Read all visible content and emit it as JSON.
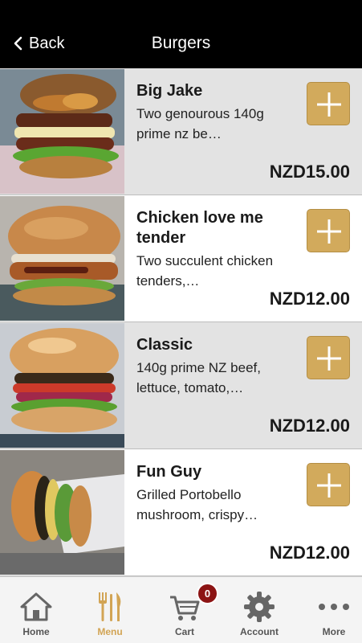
{
  "nav": {
    "back_label": "Back",
    "title": "Burgers"
  },
  "items": [
    {
      "name": "Big Jake",
      "description": "Two genourous 140g prime nz be…",
      "price": "NZD15.00",
      "image_icon": "burger-photo"
    },
    {
      "name": "Chicken love me tender",
      "description": "Two succulent chicken tenders,…",
      "price": "NZD12.00",
      "image_icon": "burger-photo"
    },
    {
      "name": "Classic",
      "description": "140g prime NZ beef, lettuce, tomato,…",
      "price": "NZD12.00",
      "image_icon": "burger-photo"
    },
    {
      "name": "Fun Guy",
      "description": "Grilled Portobello mushroom, crispy…",
      "price": "NZD12.00",
      "image_icon": "burger-photo"
    }
  ],
  "add_icon": "plus-icon",
  "tabs": [
    {
      "label": "Home",
      "icon": "home-icon"
    },
    {
      "label": "Menu",
      "icon": "fork-knife-icon",
      "active": true
    },
    {
      "label": "Cart",
      "icon": "cart-icon",
      "badge": "0"
    },
    {
      "label": "Account",
      "icon": "gear-icon"
    },
    {
      "label": "More",
      "icon": "more-dots-icon"
    }
  ],
  "colors": {
    "accent": "#d2aa5c",
    "active_tab": "#d2a454",
    "badge": "#8c1414",
    "row_alt": "#e3e3e3"
  }
}
